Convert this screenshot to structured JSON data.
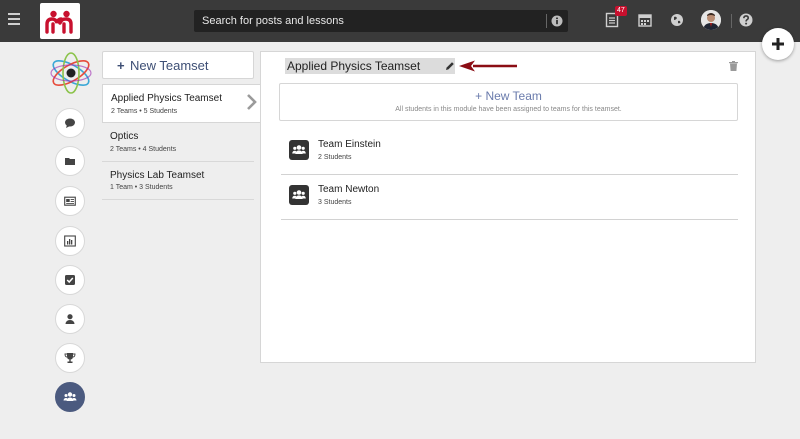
{
  "header": {
    "search_placeholder": "Search for posts and lessons",
    "notification_count": "47"
  },
  "teamsets": {
    "new_label": "New Teamset",
    "items": [
      {
        "name": "Applied Physics Teamset",
        "meta": "2 Teams • 5 Students"
      },
      {
        "name": "Optics",
        "meta": "2 Teams • 4 Students"
      },
      {
        "name": "Physics Lab Teamset",
        "meta": "1 Team • 3 Students"
      }
    ]
  },
  "main": {
    "title": "Applied Physics Teamset",
    "new_team_label": "New Team",
    "new_team_note": "All students in this module have been assigned to teams for this teamset.",
    "teams": [
      {
        "name": "Team Einstein",
        "meta": "2 Students"
      },
      {
        "name": "Team Newton",
        "meta": "3 Students"
      }
    ]
  },
  "colors": {
    "topbar": "#3a3a3a",
    "accent": "#3e4f75",
    "active_rail": "#4b5a7f",
    "arrow": "#8b0d14",
    "badge": "#c8102e"
  },
  "icons": [
    "menu-icon",
    "logo-icon",
    "info-icon",
    "document-icon",
    "calendar-icon",
    "globe-icon",
    "help-icon",
    "plus-icon",
    "atom-icon",
    "chat-icon",
    "folder-icon",
    "newspaper-icon",
    "bar-chart-icon",
    "checkbox-icon",
    "user-icon",
    "trophy-icon",
    "group-icon",
    "pencil-icon",
    "trash-icon",
    "chevron-right-icon",
    "arrow-left-icon"
  ]
}
